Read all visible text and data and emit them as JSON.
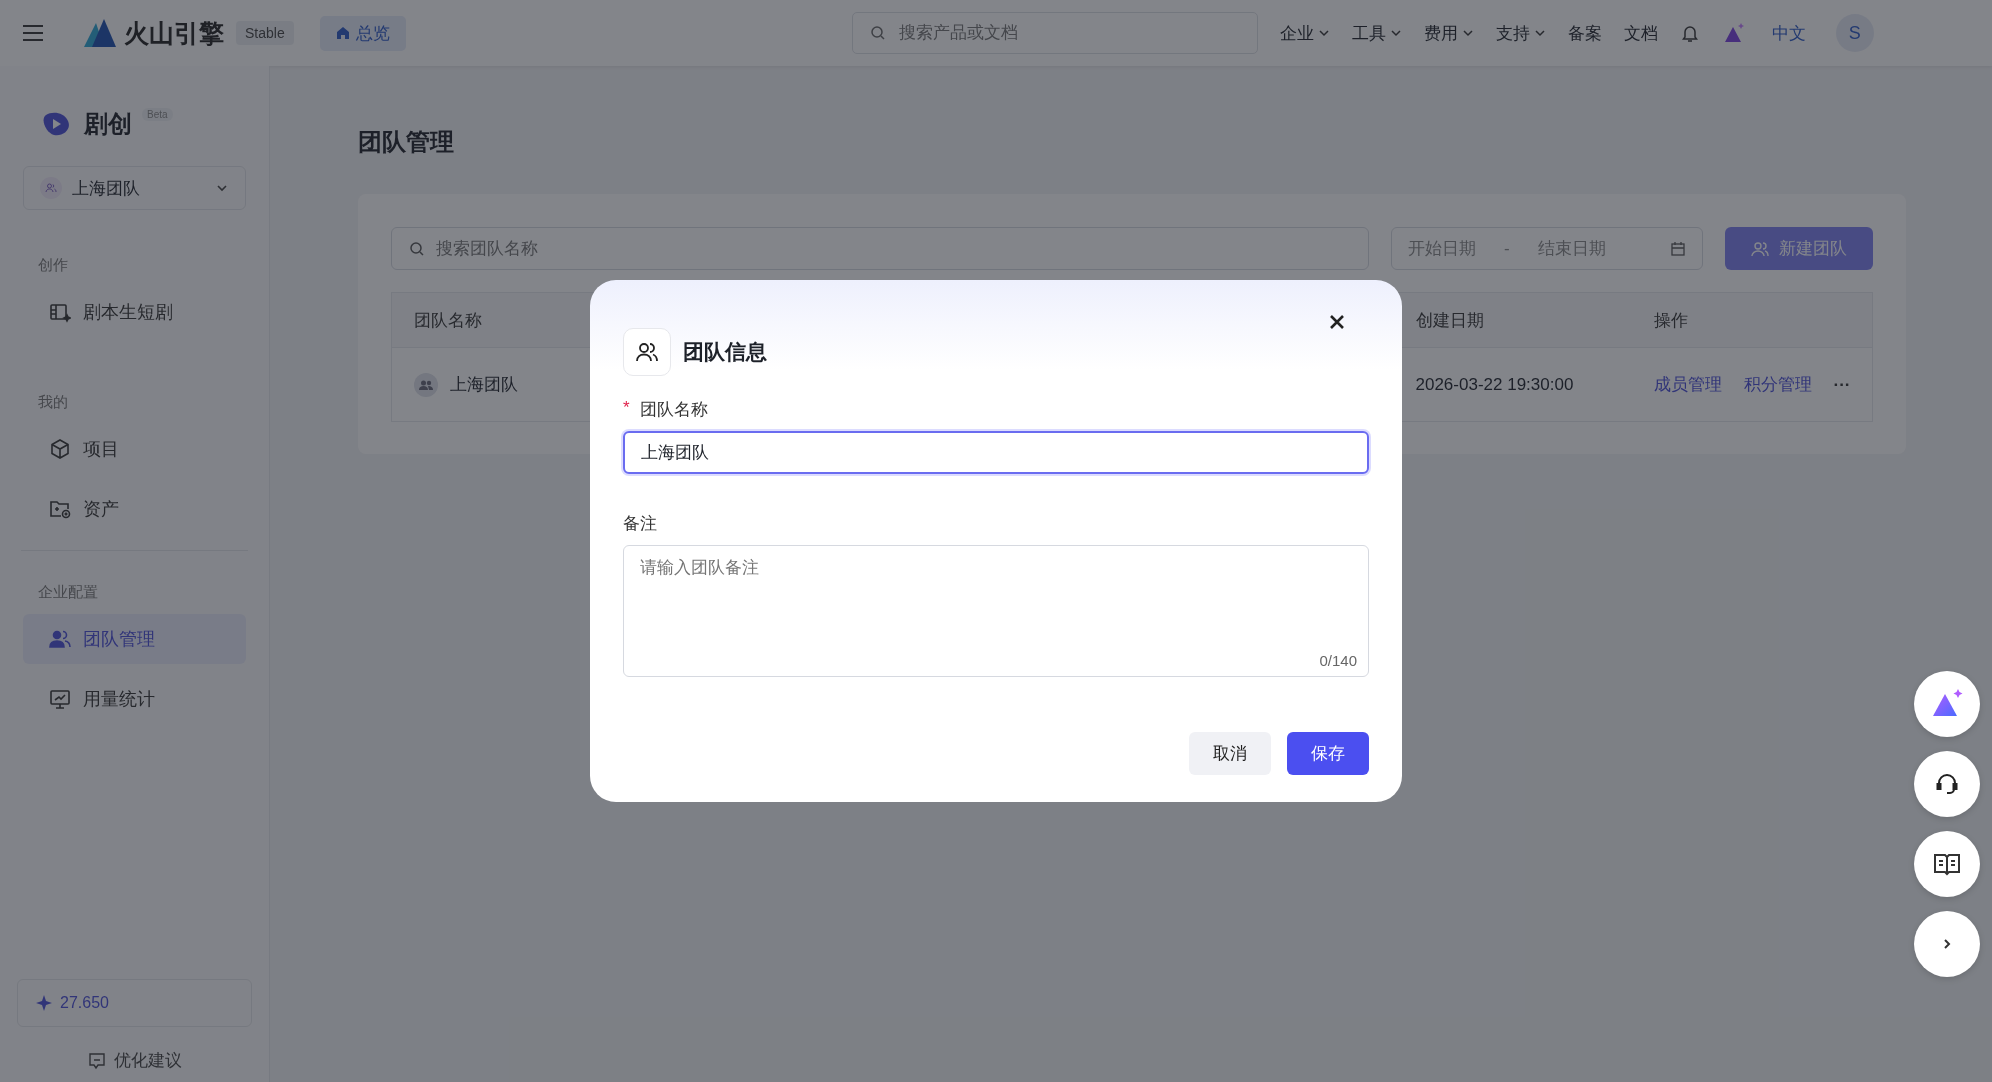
{
  "topbar": {
    "brand": "火山引擎",
    "channel": "Stable",
    "tabs": [
      {
        "label": "总览",
        "selected": true
      }
    ],
    "search": {
      "placeholder": "搜索产品或文档"
    },
    "nav": [
      {
        "label": "企业",
        "kind": "dropdown"
      },
      {
        "label": "工具",
        "kind": "dropdown"
      },
      {
        "label": "费用",
        "kind": "dropdown"
      },
      {
        "label": "支持",
        "kind": "dropdown"
      },
      {
        "label": "备案",
        "kind": "link"
      },
      {
        "label": "文档",
        "kind": "link"
      }
    ],
    "language": "中文",
    "avatar": "S"
  },
  "sidebar": {
    "app": "剧创",
    "app_tag": "Beta",
    "team": "上海团队",
    "sections": [
      {
        "title": "创作",
        "items": [
          {
            "label": "剧本生短剧",
            "kind": "film",
            "selected": false
          }
        ]
      },
      {
        "title": "我的",
        "items": [
          {
            "label": "项目",
            "kind": "cube",
            "selected": false
          },
          {
            "label": "资产",
            "kind": "folder",
            "selected": false
          }
        ]
      },
      {
        "title": "企业配置",
        "items": [
          {
            "label": "团队管理",
            "kind": "team",
            "selected": true
          },
          {
            "label": "用量统计",
            "kind": "monitor",
            "selected": false
          }
        ]
      }
    ],
    "credits": "27.650",
    "feedback": "优化建议"
  },
  "page": {
    "title": "团队管理",
    "search": {
      "placeholder": "搜索团队名称"
    },
    "date_range": {
      "start_placeholder": "开始日期",
      "separator": "-",
      "end_placeholder": "结束日期"
    },
    "new_button": "新建团队",
    "table": {
      "columns": [
        "团队名称",
        "创建日期",
        "操作"
      ],
      "rows": [
        {
          "name": "上海团队",
          "created": "2026-03-22 19:30:00",
          "actions": [
            "成员管理",
            "积分管理"
          ],
          "more": "···"
        }
      ]
    }
  },
  "dialog": {
    "title": "团队信息",
    "fields": [
      {
        "label": "团队名称",
        "required_mark": "*",
        "kind": "input",
        "value": "上海团队"
      },
      {
        "label": "备注",
        "kind": "textarea",
        "placeholder": "请输入团队备注",
        "counter": "0/140"
      }
    ],
    "buttons": [
      {
        "label": "取消",
        "kind": "secondary"
      },
      {
        "label": "保存",
        "kind": "primary"
      }
    ]
  }
}
